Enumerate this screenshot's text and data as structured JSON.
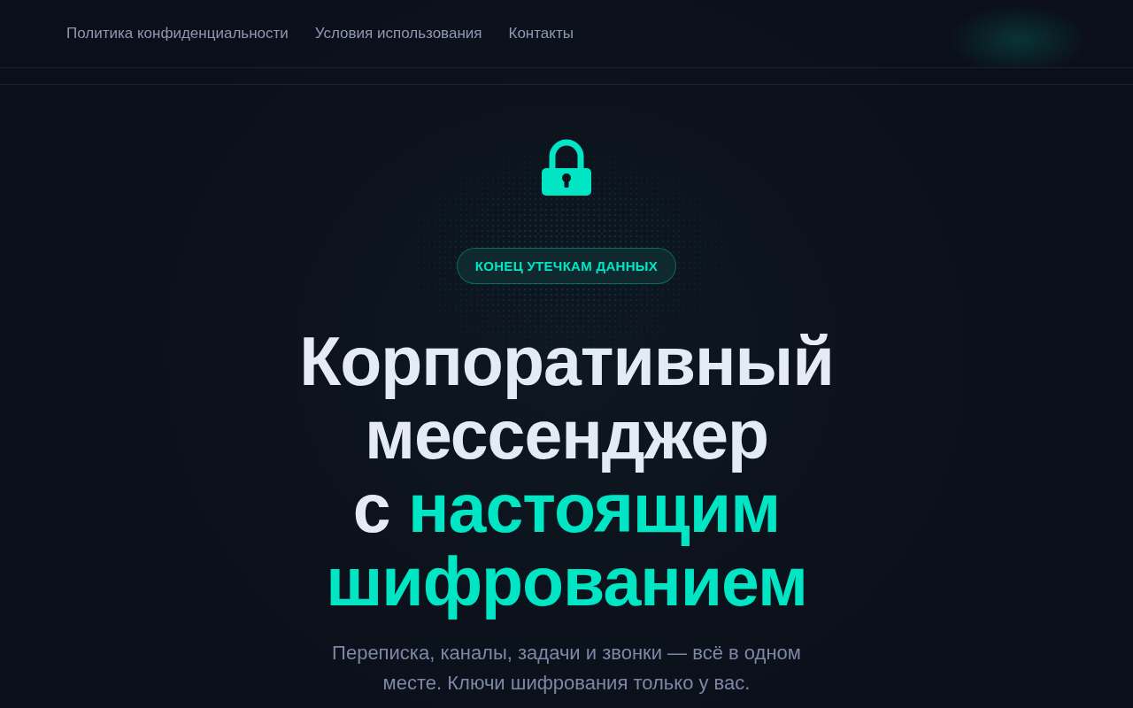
{
  "nav": {
    "links": [
      "Политика конфиденциальности",
      "Условия использования",
      "Контакты"
    ]
  },
  "hero": {
    "badge": "КОНЕЦ УТЕЧКАМ ДАННЫХ",
    "title_lead": "Корпоративный мессенджер",
    "title_prefix": "с",
    "title_accent": "настоящим шифрованием",
    "subtitle": "Переписка, каналы, задачи и звонки — всё в одном месте. Ключи шифрования только у вас."
  }
}
